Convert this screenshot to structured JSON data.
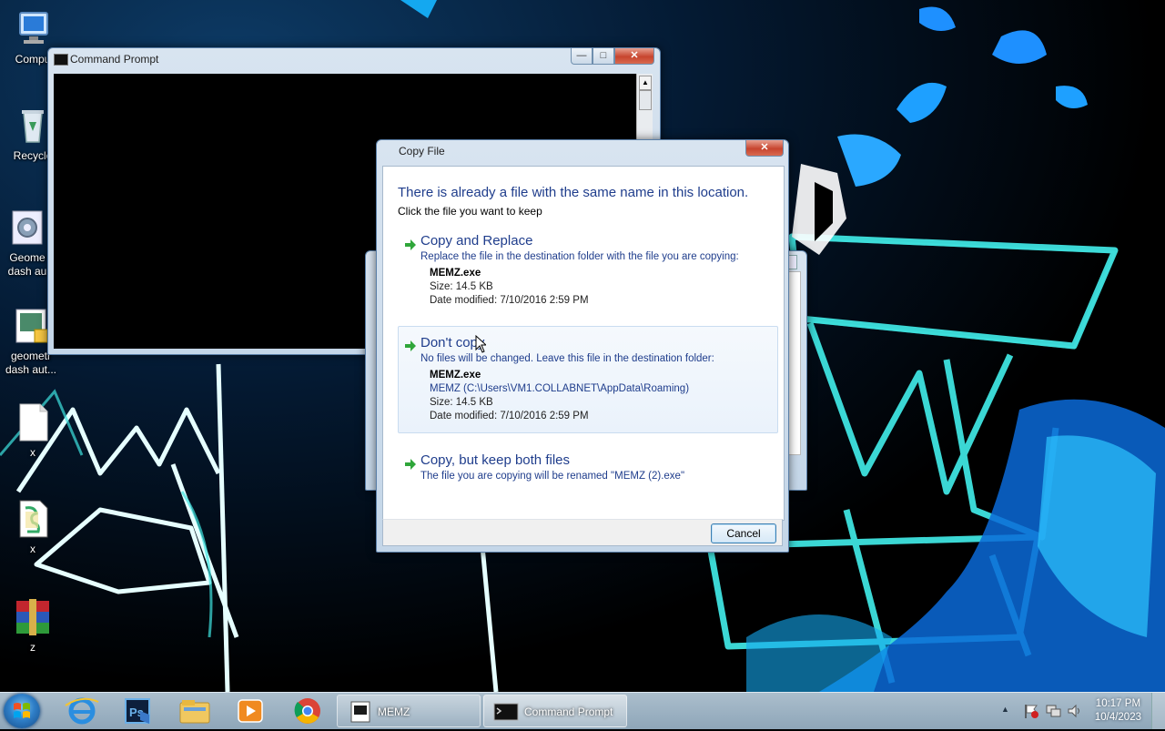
{
  "desktop": {
    "icons": [
      {
        "label": "Compu"
      },
      {
        "label": "Recycle"
      },
      {
        "label": "Geome dash au"
      },
      {
        "label": "geometr dash aut..."
      },
      {
        "label": "x"
      },
      {
        "label": "x"
      },
      {
        "label": "z"
      }
    ]
  },
  "cmd_window": {
    "title": "Command Prompt",
    "minimize": "—",
    "maximize": "□",
    "close": "✕"
  },
  "dialog": {
    "title": "Copy File",
    "close": "✕",
    "heading": "There is already a file with the same name in this location.",
    "subheading": "Click the file you want to keep",
    "replace": {
      "title": "Copy and Replace",
      "desc": "Replace the file in the destination folder with the file you are copying:",
      "file_name": "MEMZ.exe",
      "size": "Size: 14.5 KB",
      "date": "Date modified: 7/10/2016 2:59 PM"
    },
    "dont_copy": {
      "title": "Don't copy",
      "desc": "No files will be changed. Leave this file in the destination folder:",
      "file_name": "MEMZ.exe",
      "path": "MEMZ (C:\\Users\\VM1.COLLABNET\\AppData\\Roaming)",
      "size": "Size: 14.5 KB",
      "date": "Date modified: 7/10/2016 2:59 PM"
    },
    "keep_both": {
      "title": "Copy, but keep both files",
      "desc": "The file you are copying will be renamed \"MEMZ (2).exe\""
    },
    "cancel": "Cancel"
  },
  "taskbar": {
    "pinned": [
      "internet-explorer-icon",
      "photoshop-icon",
      "file-explorer-icon",
      "media-player-icon",
      "chrome-icon"
    ],
    "tasks": [
      {
        "label": "MEMZ"
      },
      {
        "label": "Command Prompt"
      }
    ],
    "clock_time": "10:17 PM",
    "clock_date": "10/4/2023",
    "tray_expand": "▲"
  },
  "colors": {
    "dialog_link": "#1f3d8c",
    "neon": "#3fe3e0"
  }
}
